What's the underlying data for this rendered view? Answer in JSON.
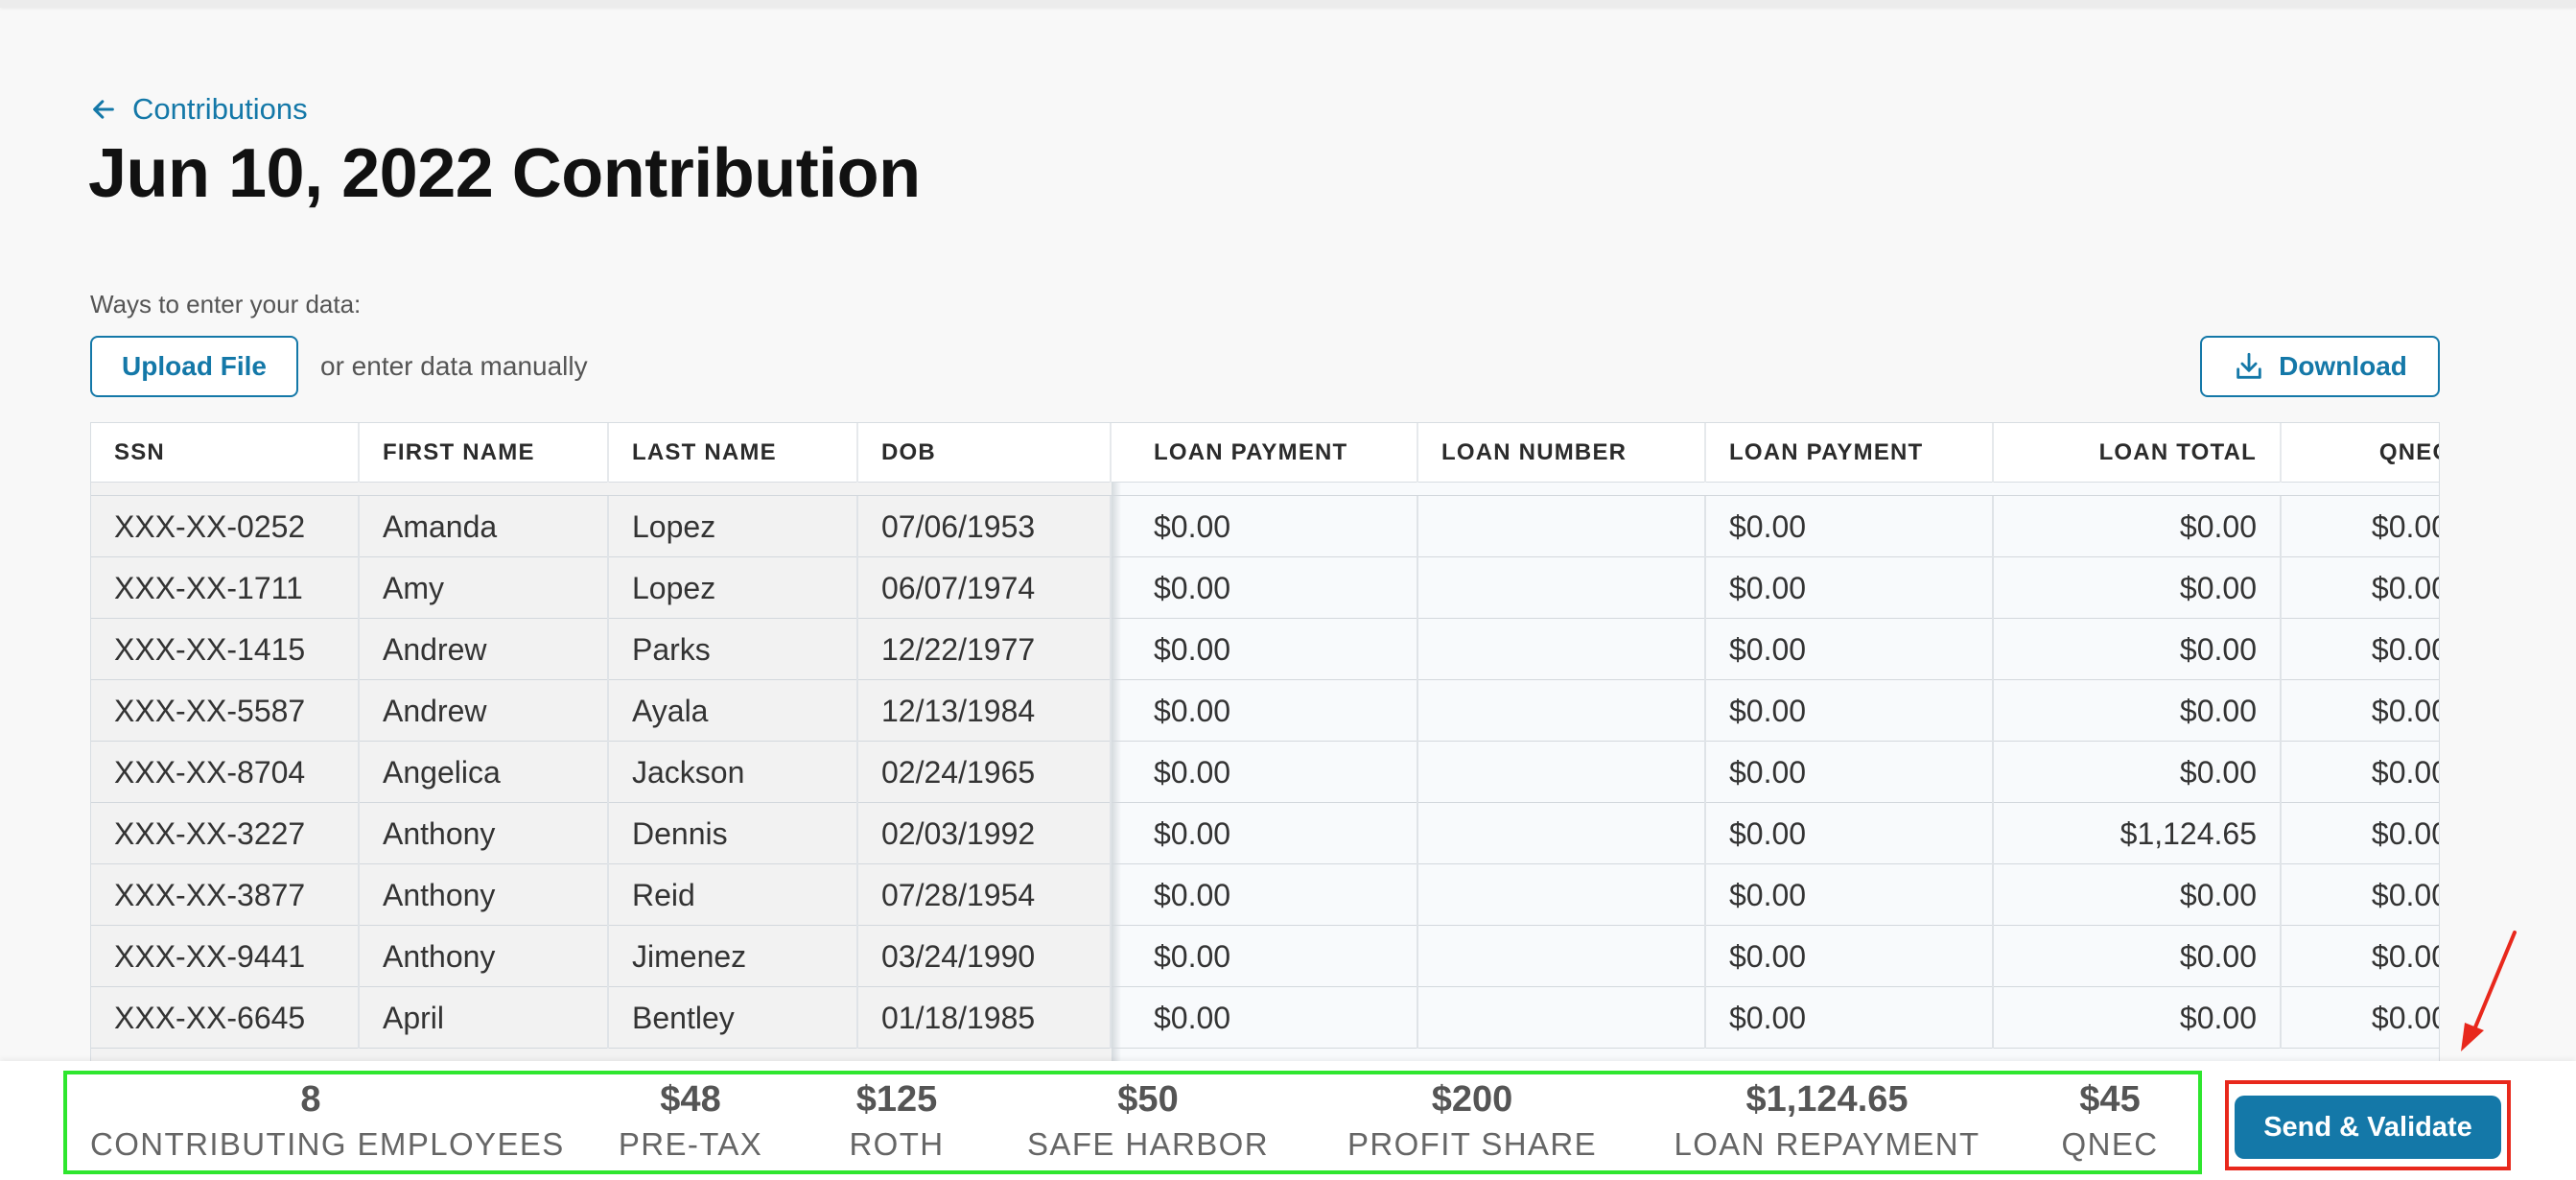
{
  "nav": {
    "back_label": "Contributions"
  },
  "page": {
    "title": "Jun 10, 2022 Contribution"
  },
  "data_entry": {
    "ways_label": "Ways to enter your data:",
    "upload_label": "Upload File",
    "manual_label": "or enter data manually",
    "download_label": "Download"
  },
  "table": {
    "frozen_headers": [
      "SSN",
      "FIRST NAME",
      "LAST NAME",
      "DOB"
    ],
    "scroll_headers": [
      "LOAN PAYMENT",
      "LOAN NUMBER",
      "LOAN PAYMENT",
      "LOAN TOTAL",
      "QNEC"
    ],
    "rows": [
      {
        "ssn": "XXX-XX-0252",
        "first": "Amanda",
        "last": "Lopez",
        "dob": "07/06/1953",
        "loan_payment_1": "$0.00",
        "loan_number": "",
        "loan_payment_2": "$0.00",
        "loan_total": "$0.00",
        "qnec": "$0.00"
      },
      {
        "ssn": "XXX-XX-1711",
        "first": "Amy",
        "last": "Lopez",
        "dob": "06/07/1974",
        "loan_payment_1": "$0.00",
        "loan_number": "",
        "loan_payment_2": "$0.00",
        "loan_total": "$0.00",
        "qnec": "$0.00"
      },
      {
        "ssn": "XXX-XX-1415",
        "first": "Andrew",
        "last": "Parks",
        "dob": "12/22/1977",
        "loan_payment_1": "$0.00",
        "loan_number": "",
        "loan_payment_2": "$0.00",
        "loan_total": "$0.00",
        "qnec": "$0.00"
      },
      {
        "ssn": "XXX-XX-5587",
        "first": "Andrew",
        "last": "Ayala",
        "dob": "12/13/1984",
        "loan_payment_1": "$0.00",
        "loan_number": "",
        "loan_payment_2": "$0.00",
        "loan_total": "$0.00",
        "qnec": "$0.00"
      },
      {
        "ssn": "XXX-XX-8704",
        "first": "Angelica",
        "last": "Jackson",
        "dob": "02/24/1965",
        "loan_payment_1": "$0.00",
        "loan_number": "",
        "loan_payment_2": "$0.00",
        "loan_total": "$0.00",
        "qnec": "$0.00"
      },
      {
        "ssn": "XXX-XX-3227",
        "first": "Anthony",
        "last": "Dennis",
        "dob": "02/03/1992",
        "loan_payment_1": "$0.00",
        "loan_number": "",
        "loan_payment_2": "$0.00",
        "loan_total": "$1,124.65",
        "qnec": "$0.00"
      },
      {
        "ssn": "XXX-XX-3877",
        "first": "Anthony",
        "last": "Reid",
        "dob": "07/28/1954",
        "loan_payment_1": "$0.00",
        "loan_number": "",
        "loan_payment_2": "$0.00",
        "loan_total": "$0.00",
        "qnec": "$0.00"
      },
      {
        "ssn": "XXX-XX-9441",
        "first": "Anthony",
        "last": "Jimenez",
        "dob": "03/24/1990",
        "loan_payment_1": "$0.00",
        "loan_number": "",
        "loan_payment_2": "$0.00",
        "loan_total": "$0.00",
        "qnec": "$0.00"
      },
      {
        "ssn": "XXX-XX-6645",
        "first": "April",
        "last": "Bentley",
        "dob": "01/18/1985",
        "loan_payment_1": "$0.00",
        "loan_number": "",
        "loan_payment_2": "$0.00",
        "loan_total": "$0.00",
        "qnec": "$0.00"
      }
    ]
  },
  "summary": [
    {
      "value": "8",
      "label": "CONTRIBUTING EMPLOYEES"
    },
    {
      "value": "$48",
      "label": "PRE-TAX"
    },
    {
      "value": "$125",
      "label": "ROTH"
    },
    {
      "value": "$50",
      "label": "SAFE HARBOR"
    },
    {
      "value": "$200",
      "label": "PROFIT SHARE"
    },
    {
      "value": "$1,124.65",
      "label": "LOAN REPAYMENT"
    },
    {
      "value": "$45",
      "label": "QNEC"
    }
  ],
  "actions": {
    "send_label": "Send & Validate"
  },
  "colors": {
    "accent": "#1478a8",
    "summary_highlight": "#2ee62e",
    "action_highlight": "#e8281c"
  },
  "icons": [
    "arrow-left-icon",
    "download-icon",
    "annotation-arrow-icon"
  ]
}
